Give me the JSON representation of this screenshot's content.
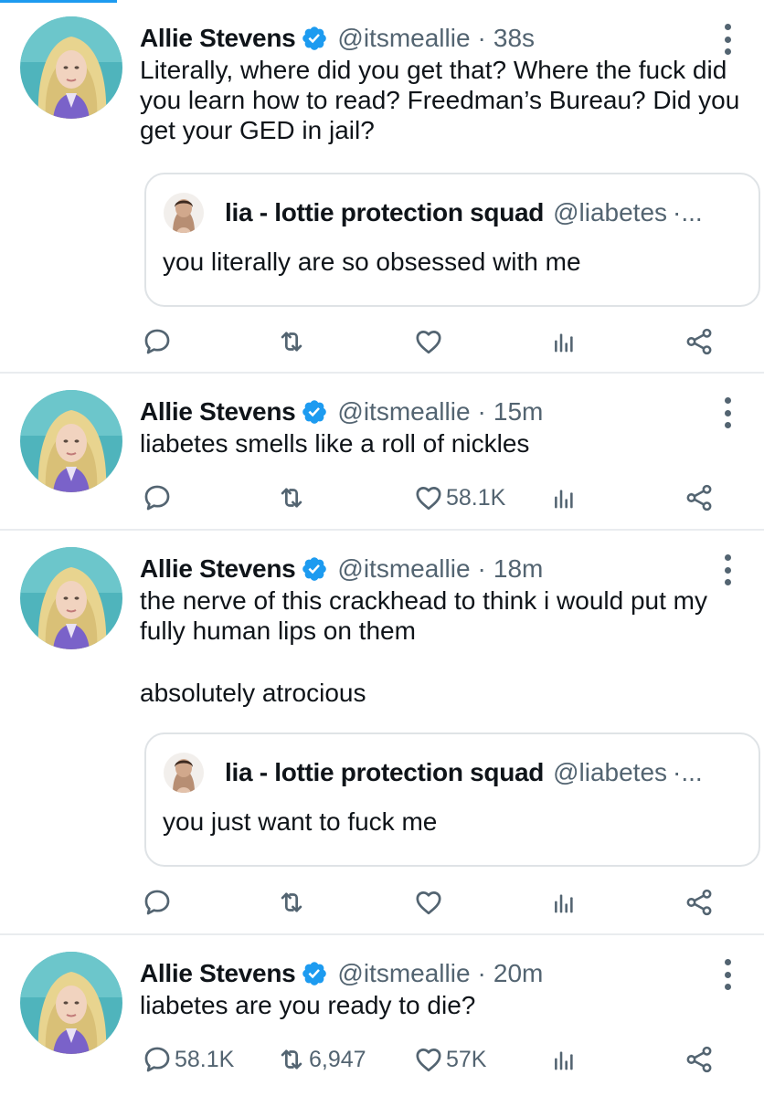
{
  "tweets": [
    {
      "author": "Allie Stevens",
      "handle": "@itsmeallie",
      "separator": "·",
      "time": "38s",
      "lines": [
        "Literally, where did you get that? Where the fuck did you learn how to read? Freedman’s Bureau? Did you get your GED in jail?"
      ],
      "quote": {
        "author": "lia - lottie protection squad",
        "handle": "@liabetes",
        "ellipsis": "·...",
        "text": "you literally are so obsessed with me"
      },
      "counts": {
        "reply": "",
        "retweet": "",
        "like": ""
      }
    },
    {
      "author": "Allie Stevens",
      "handle": "@itsmeallie",
      "separator": "·",
      "time": "15m",
      "lines": [
        "liabetes smells like a roll of nickles"
      ],
      "counts": {
        "reply": "",
        "retweet": "",
        "like": "58.1K"
      }
    },
    {
      "author": "Allie Stevens",
      "handle": "@itsmeallie",
      "separator": "·",
      "time": "18m",
      "lines": [
        "the nerve of this crackhead to think i would put my fully human lips on them",
        "absolutely atrocious"
      ],
      "quote": {
        "author": "lia - lottie protection squad",
        "handle": "@liabetes",
        "ellipsis": "·...",
        "text": "you just want to fuck me"
      },
      "counts": {
        "reply": "",
        "retweet": "",
        "like": ""
      }
    },
    {
      "author": "Allie Stevens",
      "handle": "@itsmeallie",
      "separator": "·",
      "time": "20m",
      "lines": [
        "liabetes are you ready to die?"
      ],
      "counts": {
        "reply": "58.1K",
        "retweet": "6,947",
        "like": "57K"
      }
    }
  ],
  "icons": {
    "reply": "reply-icon",
    "retweet": "retweet-icon",
    "like": "heart-icon",
    "views": "views-icon",
    "share": "share-icon",
    "verified": "verified-badge-icon",
    "more": "more-options-icon"
  },
  "colors": {
    "accent": "#1d9bf0",
    "text": "#0f1419",
    "secondary": "#536471",
    "divider": "#e9ecef"
  }
}
